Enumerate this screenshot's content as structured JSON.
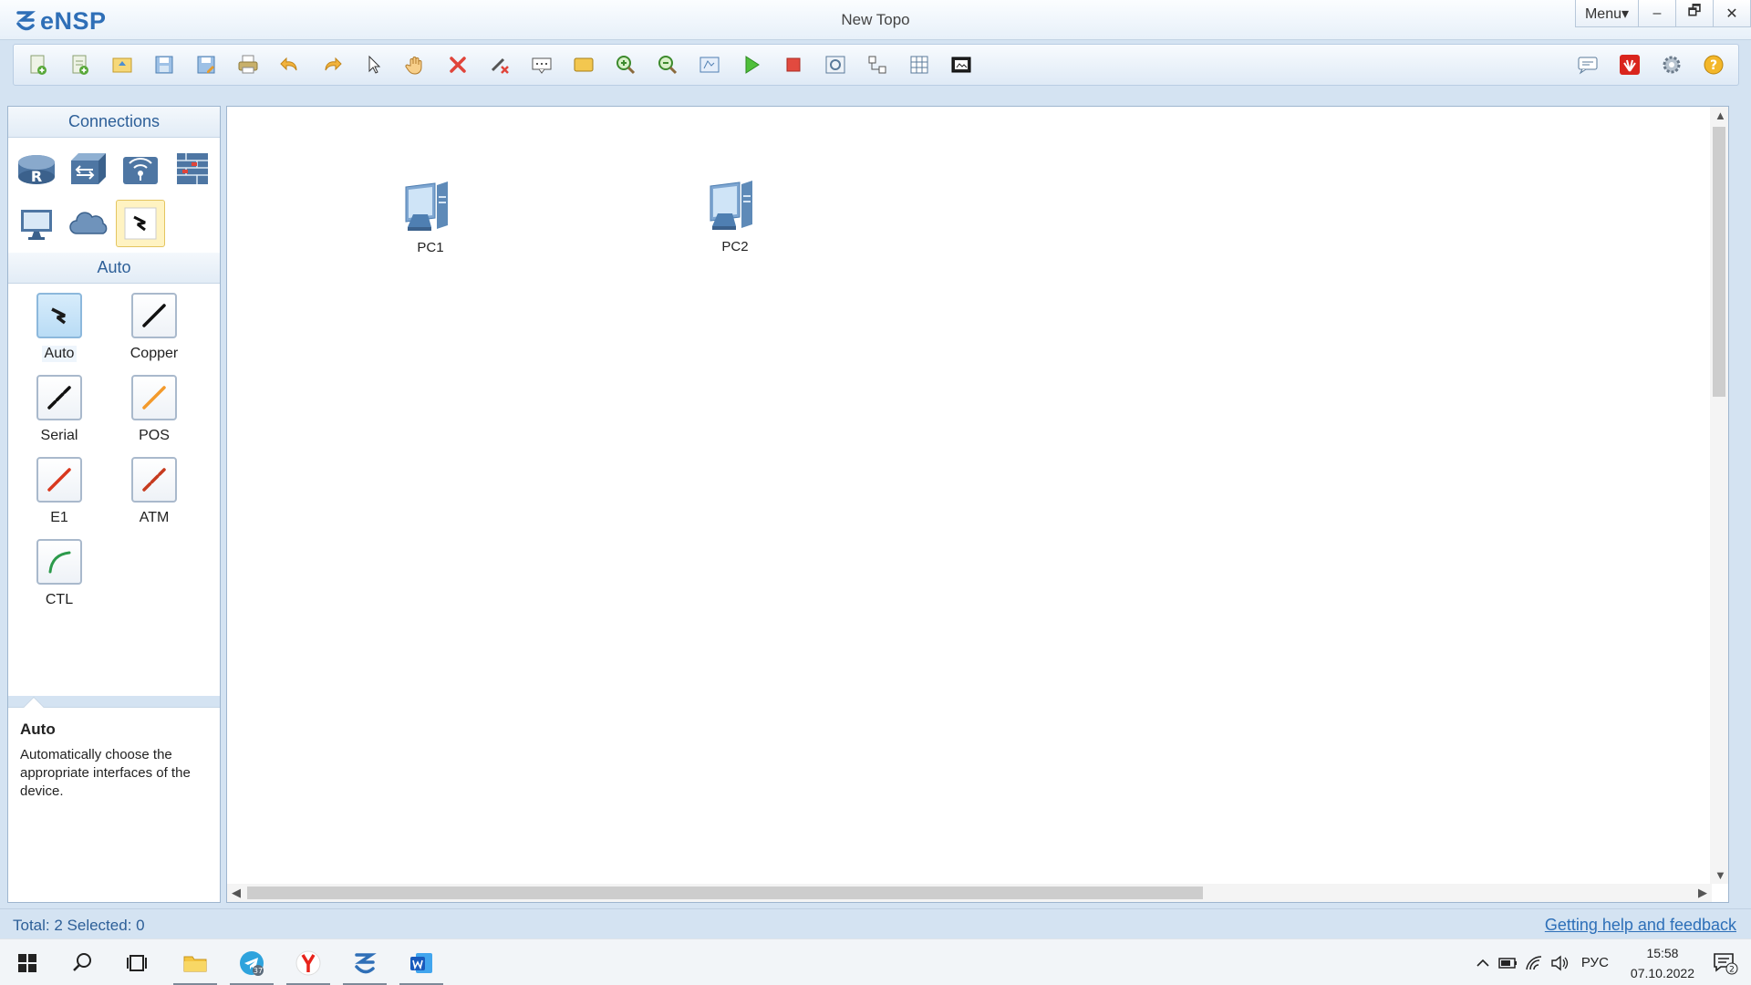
{
  "app": {
    "name": "eNSP",
    "window_title": "New Topo"
  },
  "window_controls": {
    "menu": "Menu▾",
    "minimize": "–",
    "restore": "🗗",
    "close": "✕"
  },
  "palette": {
    "connections_header": "Connections",
    "auto_header": "Auto",
    "cables": [
      {
        "label": "Auto",
        "color": "#1a1a1a"
      },
      {
        "label": "Copper",
        "color": "#111111"
      },
      {
        "label": "Serial",
        "color": "#111111"
      },
      {
        "label": "POS",
        "color": "#f39a2c"
      },
      {
        "label": "E1",
        "color": "#d9381e"
      },
      {
        "label": "ATM",
        "color": "#c63b1f"
      },
      {
        "label": "CTL",
        "color": "#2c9a4b"
      }
    ],
    "description": {
      "title": "Auto",
      "text": "Automatically choose the appropriate interfaces of the device."
    }
  },
  "canvas": {
    "nodes": [
      {
        "label": "PC1"
      },
      {
        "label": "PC2"
      }
    ]
  },
  "status": {
    "summary": "Total: 2  Selected: 0",
    "help_link": "Getting help and feedback"
  },
  "taskbar": {
    "telegram_badge": "37",
    "language": "РУС",
    "time": "15:58",
    "date": "07.10.2022",
    "notifications": "2"
  },
  "colors": {
    "accent": "#2d5f98",
    "selected_device": "#fff3c2"
  }
}
